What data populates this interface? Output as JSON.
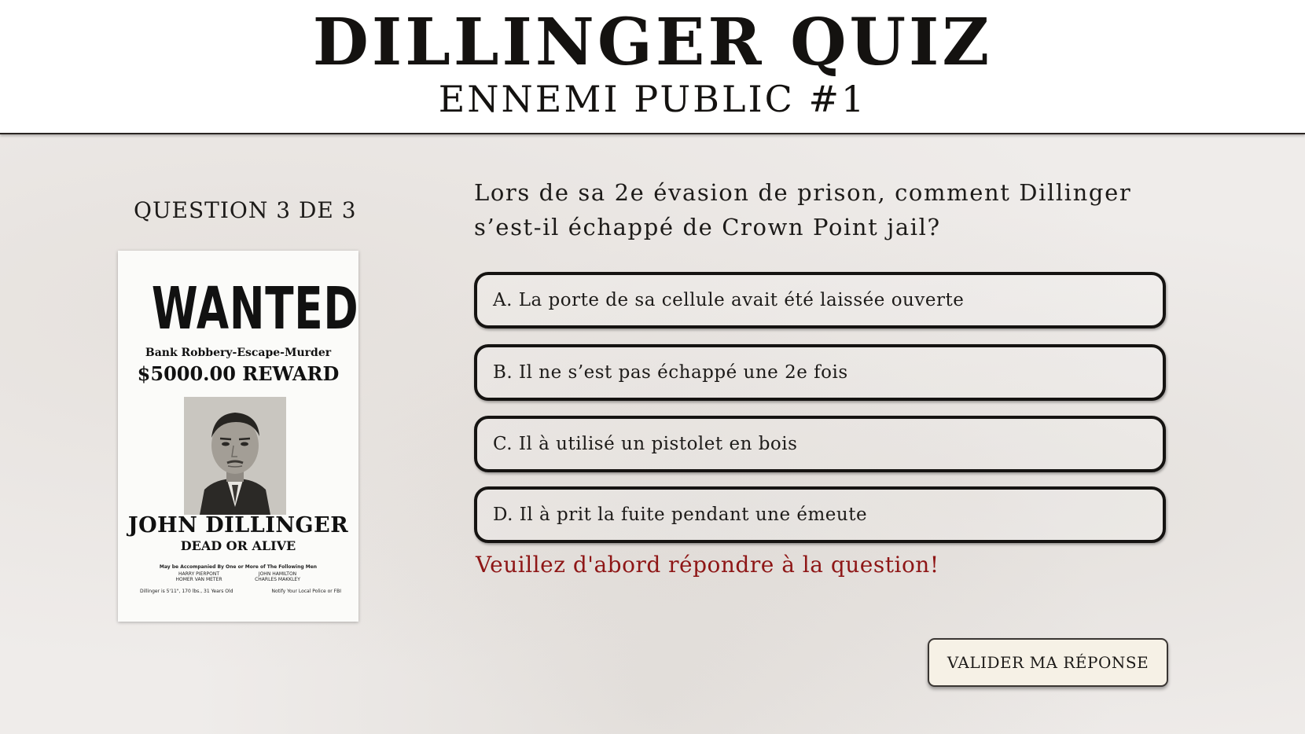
{
  "header": {
    "title": "DILLINGER QUIZ",
    "subtitle": "ENNEMI PUBLIC #1"
  },
  "quiz": {
    "counter": "QUESTION 3 DE 3",
    "question": "Lors de sa 2e évasion de prison, comment Dillinger s’est-il échappé de Crown Point jail?",
    "answers": [
      {
        "label": "A. La porte de sa cellule avait été laissée ouverte"
      },
      {
        "label": "B. Il ne s’est pas échappé une 2e fois"
      },
      {
        "label": "C. Il à utilisé un pistolet en bois"
      },
      {
        "label": "D. Il à prit la fuite pendant une émeute"
      }
    ],
    "error_message": "Veuillez d'abord répondre à la question!",
    "submit_label": "VALIDER MA RÉPONSE"
  },
  "poster": {
    "wanted": "WANTED",
    "crimes": "Bank Robbery-Escape-Murder",
    "reward": "$5000.00 REWARD",
    "name": "JOHN DILLINGER",
    "status": "DEAD OR ALIVE",
    "accomplices_heading": "May be Accompanied By One or More of The Following Men",
    "accomplices_left": "HARRY PIERPONT\nHOMER VAN METER",
    "accomplices_right": "JOHN HAMILTON\nCHARLES MAKKLEY",
    "footer_left": "Dillinger is 5'11\", 170 lbs., 31 Years Old",
    "footer_right": "Notify Your Local Police or FBI"
  },
  "colors": {
    "error": "#8e1616",
    "background": "#efecea",
    "button_bg": "#f6f1e6",
    "ink": "#1d1b19"
  }
}
